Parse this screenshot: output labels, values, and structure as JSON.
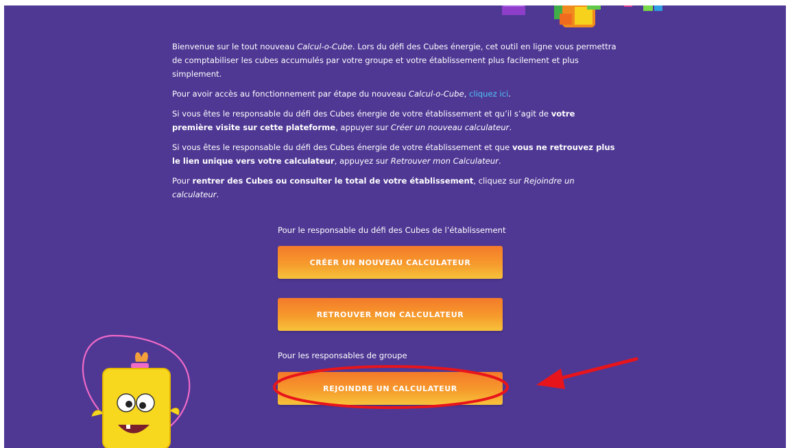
{
  "intro": {
    "p1": {
      "t1": "Bienvenue sur le tout nouveau ",
      "brand": "Calcul-o-Cube",
      "t2": ". Lors du défi des Cubes énergie, cet outil en ligne vous permettra de comptabiliser les cubes accumulés par votre groupe et votre établissement plus facilement et plus simplement."
    },
    "p2": {
      "t1": "Pour avoir accès au fonctionnement par étape du nouveau ",
      "brand": "Calcul-o-Cube",
      "t2": ", ",
      "link": "cliquez ici",
      "t3": "."
    },
    "p3": {
      "t1": "Si vous êtes le responsable du défi des Cubes énergie de votre établissement et qu’il s’agit de ",
      "b1": "votre première visite sur cette plateforme",
      "t2": ", appuyer sur ",
      "i1": "Créer un nouveau calculateur",
      "t3": "."
    },
    "p4": {
      "t1": "Si vous êtes le responsable du défi des Cubes énergie de votre établissement et que ",
      "b1": "vous ne retrouvez plus le lien unique vers votre calculateur",
      "t2": ", appuyez sur ",
      "i1": "Retrouver mon Calculateur",
      "t3": "."
    },
    "p5": {
      "t1": "Pour ",
      "b1": "rentrer des Cubes ou consulter le total de votre établissement",
      "t2": ", cliquez sur ",
      "i1": "Rejoindre un calculateur",
      "t3": "."
    }
  },
  "responsible": {
    "label": "Pour le responsable du défi des Cubes de l’établissement",
    "create_button": "CRÉER UN NOUVEAU CALCULATEUR",
    "find_button": "RETROUVER MON CALCULATEUR"
  },
  "groups": {
    "label": "Pour les responsables de groupe",
    "join_button": "REJOINDRE UN CALCULATEUR"
  },
  "colors": {
    "background": "#4f3894",
    "button_top": "#f47a2a",
    "button_bottom": "#f7c33a",
    "link": "#4fc3f7",
    "annotation": "#e8141b"
  },
  "icons": {
    "header": "colored-cubes-decoration",
    "mascot": "yellow-cube-mascot-jump-rope",
    "annotation": "red-arrow-and-ellipse"
  }
}
